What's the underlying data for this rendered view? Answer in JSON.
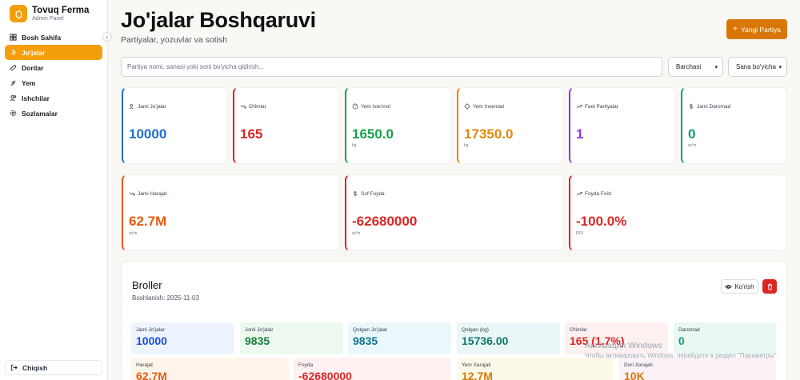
{
  "brand": {
    "title": "Tovuq Ferma",
    "subtitle": "Admin Panel"
  },
  "nav": [
    {
      "label": "Bosh Sahifa",
      "icon": "layout-grid-icon",
      "active": false
    },
    {
      "label": "Jo'jalar",
      "icon": "bird-icon",
      "active": true
    },
    {
      "label": "Dorilar",
      "icon": "pill-icon",
      "active": false
    },
    {
      "label": "Yem",
      "icon": "wheat-icon",
      "active": false
    },
    {
      "label": "Ishchilar",
      "icon": "users-icon",
      "active": false
    },
    {
      "label": "Sozlamalar",
      "icon": "gear-icon",
      "active": false
    }
  ],
  "logout": "Chiqish",
  "header": {
    "title": "Jo'jalar Boshqaruvi",
    "subtitle": "Partiyalar, yozuvlar va sotish",
    "new_button": "Yangi Partiya"
  },
  "filters": {
    "search_placeholder": "Partiya nomi, sanasi yoki soni bo'yicha qidirish...",
    "status": "Barchasi",
    "sort": "Sana bo'yicha"
  },
  "stats_row1": [
    {
      "label": "Jami Jo'jalar",
      "value": "10000",
      "unit": "",
      "color": "#1d6fd1",
      "icon": "users-icon"
    },
    {
      "label": "O'limlar",
      "value": "165",
      "unit": "",
      "color": "#dc2626",
      "icon": "trend-down-icon"
    },
    {
      "label": "Yem Iste'mol",
      "value": "1650.0",
      "unit": "kg",
      "color": "#16a34a",
      "icon": "scale-icon"
    },
    {
      "label": "Yem Inventari",
      "value": "17350.0",
      "unit": "kg",
      "color": "#e08a0c",
      "icon": "diamond-icon"
    },
    {
      "label": "Faol Partiyalar",
      "value": "1",
      "unit": "",
      "color": "#9333ea",
      "icon": "trend-up-icon"
    },
    {
      "label": "Jami Daromad",
      "value": "0",
      "unit": "so'm",
      "color": "#0f9d7a",
      "icon": "dollar-icon"
    }
  ],
  "stats_row2": [
    {
      "label": "Jami Harajat",
      "value": "62.7M",
      "unit": "so'm",
      "color": "#ea580c",
      "icon": "trend-down-icon"
    },
    {
      "label": "Sof Foyda",
      "value": "-62680000",
      "unit": "so'm",
      "color": "#dc2626",
      "icon": "dollar-icon"
    },
    {
      "label": "Foyda Foizi",
      "value": "-100.0%",
      "unit": "ROI",
      "color": "#dc2626",
      "icon": "trend-up-icon"
    }
  ],
  "batch": {
    "name": "Broller",
    "start": "Boshlanish: 2025-11-03",
    "view_label": "Ko'rish",
    "row1": [
      {
        "label": "Jami Jo'jalar",
        "value": "10000",
        "bg": "#eef4fd",
        "color": "#1d4ed8"
      },
      {
        "label": "Jonli Jo'jalar",
        "value": "9835",
        "bg": "#edf8ef",
        "color": "#15803d"
      },
      {
        "label": "Qolgan Jo'jalar",
        "value": "9835",
        "bg": "#ebf8fb",
        "color": "#0e7490"
      },
      {
        "label": "Qolgan (kg)",
        "value": "15736.00",
        "bg": "#eaf7f6",
        "color": "#0f766e"
      },
      {
        "label": "O'limlar",
        "value": "165 (1.7%)",
        "bg": "#fdf0f0",
        "color": "#dc2626"
      },
      {
        "label": "Daromad",
        "value": "0",
        "bg": "#eaf8f2",
        "color": "#0f9d7a"
      }
    ],
    "row2": [
      {
        "label": "Harajat",
        "value": "62.7M",
        "bg": "#fff4ea",
        "color": "#ea580c"
      },
      {
        "label": "Foyda",
        "value": "-62680000",
        "bg": "#fff1f1",
        "color": "#dc2626"
      },
      {
        "label": "Yem Xarajati",
        "value": "12.7M",
        "bg": "#fdf9e8",
        "color": "#d97706"
      },
      {
        "label": "Dori Xarajati",
        "value": "10K",
        "bg": "#fbf2f8",
        "color": "#d97706"
      }
    ]
  },
  "watermark": {
    "line1": "Активация Windows",
    "line2": "Чтобы активировать Windows, перейдите в раздел \"Параметры\"."
  }
}
